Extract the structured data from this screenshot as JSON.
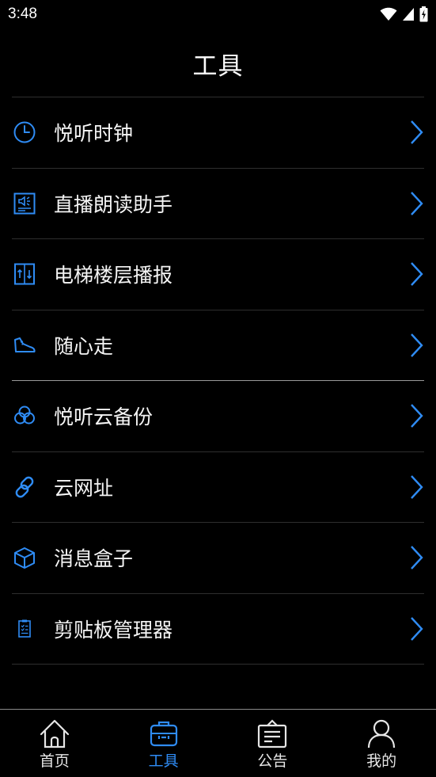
{
  "status_bar": {
    "time": "3:48"
  },
  "page": {
    "title": "工具"
  },
  "colors": {
    "accent": "#2f8cf5",
    "background": "#000000",
    "text": "#ffffff"
  },
  "tools": [
    {
      "label": "悦听时钟",
      "icon": "clock-icon"
    },
    {
      "label": "直播朗读助手",
      "icon": "live-speaker-icon"
    },
    {
      "label": "电梯楼层播报",
      "icon": "elevator-icon"
    },
    {
      "label": "随心走",
      "icon": "sneaker-icon"
    },
    {
      "label": "悦听云备份",
      "icon": "cloud-backup-icon"
    },
    {
      "label": "云网址",
      "icon": "link-icon"
    },
    {
      "label": "消息盒子",
      "icon": "box-icon"
    },
    {
      "label": "剪贴板管理器",
      "icon": "clipboard-icon"
    }
  ],
  "nav": [
    {
      "label": "首页",
      "icon": "home-icon",
      "active": false
    },
    {
      "label": "工具",
      "icon": "toolbox-icon",
      "active": true
    },
    {
      "label": "公告",
      "icon": "notice-icon",
      "active": false
    },
    {
      "label": "我的",
      "icon": "profile-icon",
      "active": false
    }
  ]
}
